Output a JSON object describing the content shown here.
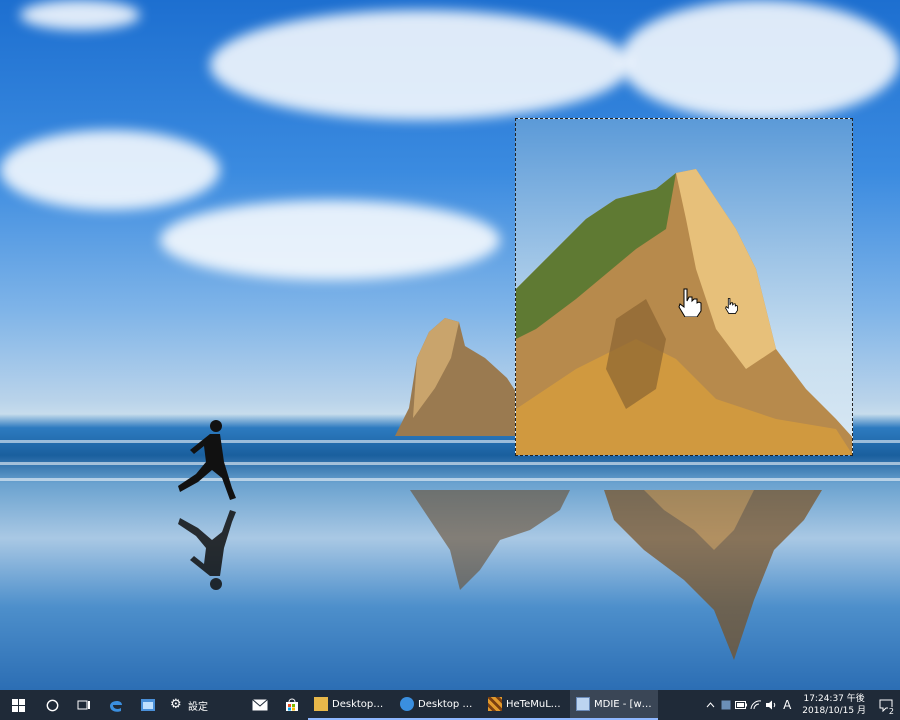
{
  "taskbar": {
    "settings_label": "設定",
    "apps": [
      {
        "label": "Desktopzoom..."
      },
      {
        "label": "Desktop Appli..."
      },
      {
        "label": "HeTeMuLu Cr..."
      },
      {
        "label": "MDIE - [wallp..."
      }
    ]
  },
  "tray": {
    "ime": "A",
    "time": "17:24:37 午後",
    "date": "2018/10/15 月",
    "notification_count": "2"
  },
  "colors": {
    "taskbar_bg": "#1f2a38",
    "accent": "#8fb8ff"
  }
}
